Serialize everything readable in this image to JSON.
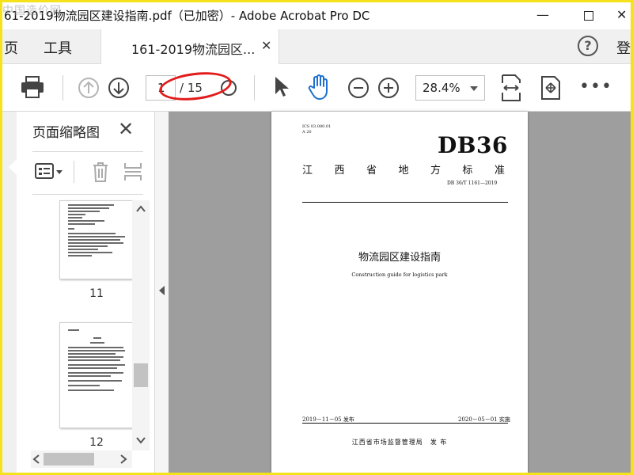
{
  "window": {
    "title": "61-2019物流园区建设指南.pdf（已加密）- Adobe Acrobat Pro DC",
    "watermark": "中国造价网",
    "minimize_glyph": "—",
    "close_glyph": "✕"
  },
  "menu": {
    "home_label": "页",
    "tools_label": "工具",
    "help_glyph": "?",
    "login_label": "登"
  },
  "tab": {
    "label": "161-2019物流园区...",
    "close_glyph": "✕"
  },
  "toolbar": {
    "icons": [
      "print-icon",
      "page-up-icon",
      "page-down-icon",
      "select-cursor-icon",
      "hand-tool-icon",
      "zoom-out-icon",
      "zoom-in-icon",
      "fit-page-icon",
      "rotate-icon",
      "more-icon"
    ],
    "page_current": "1",
    "page_total": "/ 15",
    "zoom_value": "28.4%",
    "more_glyph": "•••"
  },
  "thumbnails": {
    "panel_title": "页面缩略图",
    "close_glyph": "✕",
    "pages": [
      {
        "number": "11"
      },
      {
        "number": "12"
      }
    ]
  },
  "document": {
    "ics_line1": "ICS 03.080.01",
    "ics_line2": "A 20",
    "code": "DB36",
    "standard_chars": [
      "江",
      "西",
      "省",
      "地",
      "方",
      "标",
      "准"
    ],
    "standard_number": "DB 36/T 1161—2019",
    "title_cn": "物流园区建设指南",
    "title_en": "Construction guide for logistics park",
    "issue_date": "2019－11－05 发布",
    "implement_date": "2020－05－01 实施",
    "issuer": "江西省市场监督管理局　发 布"
  },
  "colors": {
    "annotation": "#e21a1a",
    "hand_tool": "#1f6fd1",
    "frame_border": "#f5e21a",
    "document_background": "#9e9e9e"
  }
}
